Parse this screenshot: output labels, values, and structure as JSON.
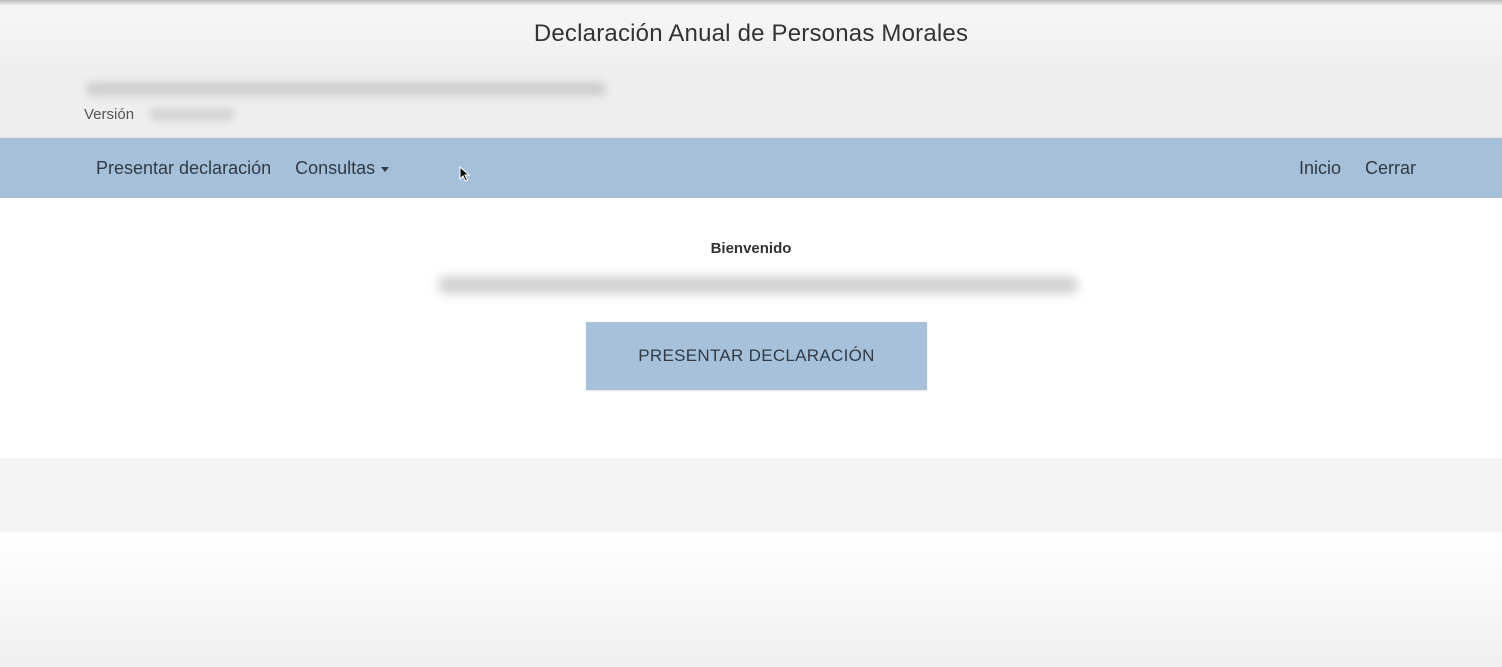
{
  "header": {
    "title": "Declaración Anual de Personas Morales",
    "version_label": "Versión"
  },
  "nav": {
    "present": "Presentar declaración",
    "queries": "Consultas",
    "home": "Inicio",
    "close": "Cerrar"
  },
  "main": {
    "welcome": "Bienvenido",
    "button_label": "PRESENTAR DECLARACIÓN"
  },
  "colors": {
    "navbar": "#a7c0da",
    "button": "#a8c1da",
    "title_bar": "#f2f2f2",
    "info_strip": "#eeeeee"
  },
  "icons": {
    "dropdown": "caret-down-icon",
    "pointer": "mouse-cursor-icon"
  }
}
